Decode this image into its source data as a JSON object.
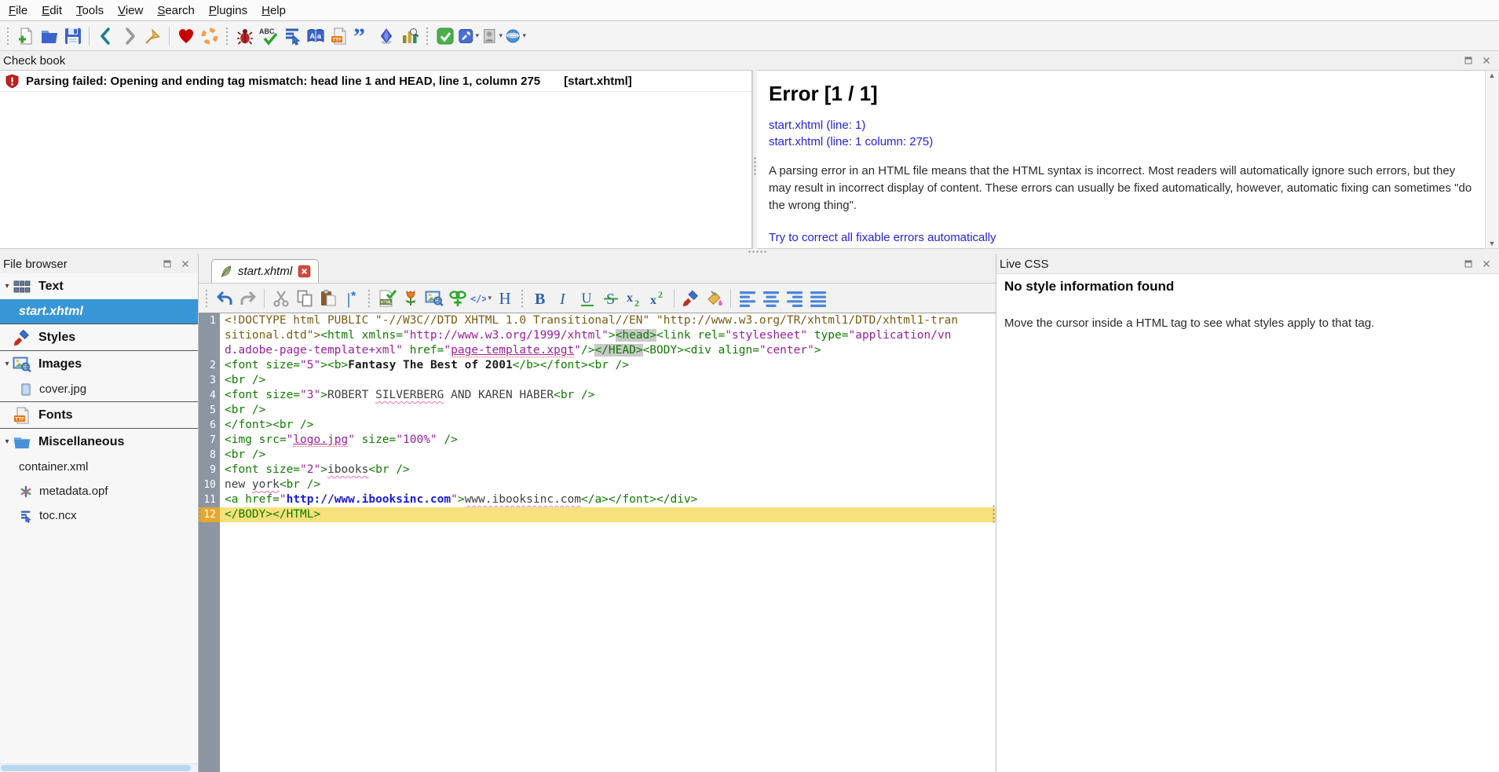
{
  "colors": {
    "accent_blue": "#3996d6",
    "current_line_bg": "#f6e17d",
    "tag_green": "#117a00",
    "value_purple": "#9a1f9a",
    "doctype_brown": "#7a5b12",
    "link_blue": "#2323e0",
    "error_red": "#c41e1e",
    "selected_gutter": "#e5a82f"
  },
  "menu": {
    "items": [
      {
        "label": "File"
      },
      {
        "label": "Edit"
      },
      {
        "label": "Tools"
      },
      {
        "label": "View"
      },
      {
        "label": "Search"
      },
      {
        "label": "Plugins"
      },
      {
        "label": "Help"
      }
    ]
  },
  "main_toolbar": {
    "buttons": [
      {
        "type": "grip"
      },
      {
        "name": "new-file-button",
        "icon": "new-file-icon"
      },
      {
        "name": "open-file-button",
        "icon": "open-folder-icon"
      },
      {
        "name": "save-button",
        "icon": "save-icon"
      },
      {
        "type": "sep"
      },
      {
        "name": "back-button",
        "icon": "back-icon"
      },
      {
        "name": "forward-button",
        "icon": "forward-icon"
      },
      {
        "name": "bookmark-button",
        "icon": "bookmark-icon"
      },
      {
        "type": "sep"
      },
      {
        "name": "donate-button",
        "icon": "donate-heart-icon"
      },
      {
        "name": "user-guide-button",
        "icon": "lifebuoy-icon"
      },
      {
        "type": "grip"
      },
      {
        "name": "well-formed-check-button",
        "icon": "bug-icon"
      },
      {
        "name": "spellcheck-button",
        "icon": "spellcheck-icon"
      },
      {
        "name": "mend-all-button",
        "icon": "mend-icon"
      },
      {
        "name": "metadata-editor-button",
        "icon": "metadata-book-icon"
      },
      {
        "name": "manage-fonts-button",
        "icon": "ttf-file-icon"
      },
      {
        "name": "clips-button",
        "icon": "quotes-icon"
      },
      {
        "name": "special-characters-button",
        "icon": "diamond-icon"
      },
      {
        "name": "reports-button",
        "icon": "reports-icon"
      },
      {
        "type": "grip"
      },
      {
        "name": "epubcheck-button",
        "icon": "epubcheck-icon"
      },
      {
        "name": "plugin-wrench-button",
        "icon": "wrench-plugin-icon",
        "dd": true
      },
      {
        "name": "plugin-photo-button",
        "icon": "photo-plugin-icon",
        "dd": true
      },
      {
        "name": "plugin-browser-button",
        "icon": "browser-plugin-icon",
        "dd": true
      }
    ]
  },
  "check_book": {
    "title": "Check book",
    "error_row": {
      "icon": "error-shield-icon",
      "message": "Parsing failed: Opening and ending tag mismatch: head line 1 and HEAD, line 1, column 275",
      "file": "[start.xhtml]"
    },
    "details": {
      "heading": "Error [1 / 1]",
      "links": [
        "start.xhtml (line: 1)",
        "start.xhtml (line: 1 column: 275)"
      ],
      "description": "A parsing error in an HTML file means that the HTML syntax is incorrect. Most readers will automatically ignore such errors, but they may result in incorrect display of content. These errors can usually be fixed automatically, however, automatic fixing can sometimes \"do the wrong thing\".",
      "action_link": "Try to correct all fixable errors automatically"
    }
  },
  "file_browser": {
    "title": "File browser",
    "groups": [
      {
        "label": "Text",
        "icon": "text-group-icon",
        "arrow": true,
        "children": [
          {
            "label": "start.xhtml",
            "selected": true
          }
        ]
      },
      {
        "label": "Styles",
        "icon": "styles-brush-icon",
        "arrow": false,
        "children": []
      },
      {
        "label": "Images",
        "icon": "images-group-icon",
        "arrow": true,
        "children": [
          {
            "label": "cover.jpg",
            "icon": "image-file-icon"
          }
        ]
      },
      {
        "label": "Fonts",
        "icon": "ttf-file-icon",
        "arrow": false,
        "children": []
      },
      {
        "label": "Miscellaneous",
        "icon": "misc-folder-icon",
        "arrow": true,
        "children": [
          {
            "label": "container.xml"
          },
          {
            "label": "metadata.opf",
            "icon": "opf-asterisk-icon"
          },
          {
            "label": "toc.ncx",
            "icon": "ncx-file-icon"
          }
        ]
      }
    ]
  },
  "editor": {
    "tab": {
      "label": "start.xhtml",
      "icon": "quill-icon",
      "close_icon": "tab-close-icon"
    },
    "toolbar": {
      "buttons": [
        {
          "type": "grip"
        },
        {
          "name": "undo-button",
          "icon": "undo-icon"
        },
        {
          "name": "redo-button",
          "icon": "redo-icon"
        },
        {
          "type": "sep"
        },
        {
          "name": "cut-button",
          "icon": "cut-icon"
        },
        {
          "name": "copy-button",
          "icon": "copy-icon"
        },
        {
          "name": "paste-button",
          "icon": "paste-icon"
        },
        {
          "name": "insert-marker-button",
          "icon": "insert-marker-icon"
        },
        {
          "type": "grip"
        },
        {
          "name": "mend-code-button",
          "icon": "mend-html-icon"
        },
        {
          "name": "insert-file-button",
          "icon": "tulip-icon"
        },
        {
          "name": "insert-image-button",
          "icon": "insert-image-icon"
        },
        {
          "name": "insert-link-button",
          "icon": "insert-link-icon"
        },
        {
          "name": "code-element-button",
          "icon": "code-view-icon",
          "dd": true
        },
        {
          "name": "heading-button",
          "icon": "heading-icon"
        },
        {
          "type": "grip"
        },
        {
          "name": "bold-button",
          "icon": "bold-icon"
        },
        {
          "name": "italic-button",
          "icon": "italic-icon"
        },
        {
          "name": "underline-button",
          "icon": "underline-icon"
        },
        {
          "name": "strikethrough-button",
          "icon": "strike-icon"
        },
        {
          "name": "subscript-button",
          "icon": "subscript-icon"
        },
        {
          "name": "superscript-button",
          "icon": "superscript-icon"
        },
        {
          "type": "sep"
        },
        {
          "name": "format-painter-button",
          "icon": "format-brush-icon"
        },
        {
          "name": "color-fill-button",
          "icon": "color-fill-icon"
        },
        {
          "type": "sep"
        },
        {
          "name": "align-left-button",
          "icon": "align-left-icon"
        },
        {
          "name": "align-center-button",
          "icon": "align-center-icon"
        },
        {
          "name": "align-right-button",
          "icon": "align-right-icon"
        },
        {
          "name": "align-justify-button",
          "icon": "align-justify-icon"
        }
      ]
    },
    "code": {
      "lines": [
        {
          "n": 1,
          "segs": [
            {
              "t": "<!DOCTYPE html PUBLIC \"-//W3C//DTD XHTML 1.0 Transitional//EN\" \"http://www.w3.org/TR/xhtml1/DTD/xhtml1-transitional.dtd\">",
              "c": "dt"
            },
            {
              "t": "<html",
              "c": "tg"
            },
            {
              "t": " xmlns=",
              "c": "at"
            },
            {
              "t": "\"http://www.w3.org/1999/xhtml\"",
              "c": "vl"
            },
            {
              "t": ">",
              "c": "tg"
            },
            {
              "t": "<head>",
              "c": "hm"
            },
            {
              "t": "<link",
              "c": "tg"
            },
            {
              "t": " rel=",
              "c": "at"
            },
            {
              "t": "\"stylesheet\"",
              "c": "vl"
            },
            {
              "t": " type=",
              "c": "at"
            },
            {
              "t": "\"application/vnd.adobe-page-template+xml\"",
              "c": "vl"
            },
            {
              "t": " href=",
              "c": "at"
            },
            {
              "t": "\"",
              "c": "vl"
            },
            {
              "t": "page-template.xpgt",
              "c": "vlk"
            },
            {
              "t": "\"",
              "c": "vl"
            },
            {
              "t": "/>",
              "c": "tg"
            },
            {
              "t": "</HEAD>",
              "c": "hm"
            },
            {
              "t": "<BODY>",
              "c": "tg"
            },
            {
              "t": "<div",
              "c": "tg"
            },
            {
              "t": " align=",
              "c": "at"
            },
            {
              "t": "\"center\"",
              "c": "vl"
            },
            {
              "t": ">",
              "c": "tg"
            }
          ]
        },
        {
          "n": 2,
          "segs": [
            {
              "t": "<font",
              "c": "tg"
            },
            {
              "t": " size=",
              "c": "at"
            },
            {
              "t": "\"5\"",
              "c": "vl"
            },
            {
              "t": ">",
              "c": "tg"
            },
            {
              "t": "<b>",
              "c": "tg"
            },
            {
              "t": "Fantasy The Best of 2001",
              "c": "bt"
            },
            {
              "t": "</b>",
              "c": "tg"
            },
            {
              "t": "</font>",
              "c": "tg"
            },
            {
              "t": "<br />",
              "c": "tg"
            }
          ]
        },
        {
          "n": 3,
          "segs": [
            {
              "t": "<br />",
              "c": "tg"
            }
          ]
        },
        {
          "n": 4,
          "segs": [
            {
              "t": "<font",
              "c": "tg"
            },
            {
              "t": " size=",
              "c": "at"
            },
            {
              "t": "\"3\"",
              "c": "vl"
            },
            {
              "t": ">",
              "c": "tg"
            },
            {
              "t": "ROBERT ",
              "c": "tx"
            },
            {
              "t": "SILVERBERG",
              "c": "sp"
            },
            {
              "t": " AND KAREN HABER",
              "c": "tx"
            },
            {
              "t": "<br />",
              "c": "tg"
            }
          ]
        },
        {
          "n": 5,
          "segs": [
            {
              "t": "<br />",
              "c": "tg"
            }
          ]
        },
        {
          "n": 6,
          "segs": [
            {
              "t": "</font>",
              "c": "tg"
            },
            {
              "t": "<br />",
              "c": "tg"
            }
          ]
        },
        {
          "n": 7,
          "segs": [
            {
              "t": "<img",
              "c": "tg"
            },
            {
              "t": " src=",
              "c": "at"
            },
            {
              "t": "\"",
              "c": "vl"
            },
            {
              "t": "logo.jpg",
              "c": "vlk"
            },
            {
              "t": "\"",
              "c": "vl"
            },
            {
              "t": " size=",
              "c": "at"
            },
            {
              "t": "\"100%\"",
              "c": "vl"
            },
            {
              "t": " />",
              "c": "tg"
            }
          ]
        },
        {
          "n": 8,
          "segs": [
            {
              "t": "<br />",
              "c": "tg"
            }
          ]
        },
        {
          "n": 9,
          "segs": [
            {
              "t": "<font",
              "c": "tg"
            },
            {
              "t": " size=",
              "c": "at"
            },
            {
              "t": "\"2\"",
              "c": "vl"
            },
            {
              "t": ">",
              "c": "tg"
            },
            {
              "t": "ibooks",
              "c": "sp"
            },
            {
              "t": "<br />",
              "c": "tg"
            }
          ]
        },
        {
          "n": 10,
          "segs": [
            {
              "t": "new ",
              "c": "tx"
            },
            {
              "t": "york",
              "c": "sp"
            },
            {
              "t": "<br />",
              "c": "tg"
            }
          ]
        },
        {
          "n": 11,
          "segs": [
            {
              "t": "<a",
              "c": "tg"
            },
            {
              "t": " href=",
              "c": "at"
            },
            {
              "t": "\"",
              "c": "vl"
            },
            {
              "t": "http://www.ibooksinc.com",
              "c": "bu"
            },
            {
              "t": "\"",
              "c": "vl"
            },
            {
              "t": ">",
              "c": "tg"
            },
            {
              "t": "www.ibooksinc.com",
              "c": "sp"
            },
            {
              "t": "</a>",
              "c": "tg"
            },
            {
              "t": "</font>",
              "c": "tg"
            },
            {
              "t": "</div>",
              "c": "tg"
            }
          ]
        },
        {
          "n": 12,
          "current": true,
          "segs": [
            {
              "t": "</BODY>",
              "c": "tg"
            },
            {
              "t": "</HTML>",
              "c": "tg"
            }
          ]
        }
      ]
    }
  },
  "live_css": {
    "title": "Live CSS",
    "heading": "No style information found",
    "message": "Move the cursor inside a HTML tag to see what styles apply to that tag."
  }
}
